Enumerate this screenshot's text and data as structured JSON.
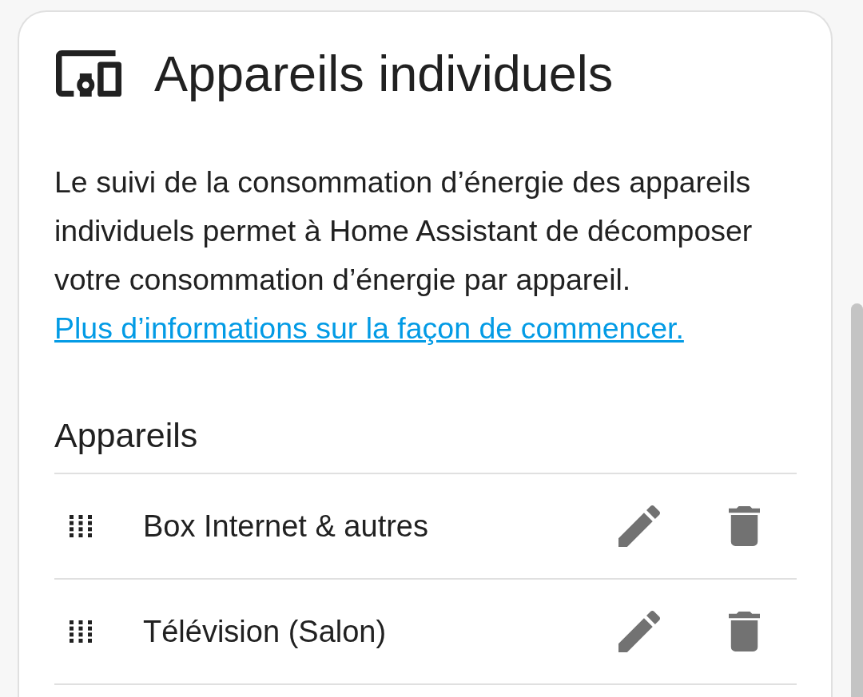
{
  "card": {
    "title": "Appareils individuels",
    "description": "Le suivi de la consommation d’énergie des appareils individuels permet à Home Assistant de décomposer votre consommation d’énergie par appareil.",
    "link": "Plus d’informations sur la façon de commencer.",
    "section_title": "Appareils",
    "devices": [
      {
        "name": "Box Internet & autres"
      },
      {
        "name": "Télévision (Salon)"
      }
    ]
  }
}
